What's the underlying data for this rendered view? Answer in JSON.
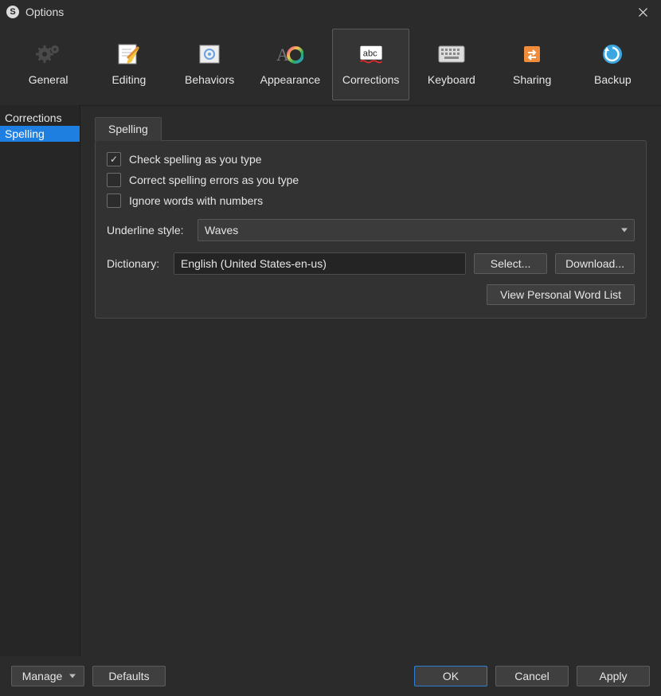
{
  "window": {
    "title": "Options"
  },
  "toolbar": {
    "items": [
      {
        "label": "General"
      },
      {
        "label": "Editing"
      },
      {
        "label": "Behaviors"
      },
      {
        "label": "Appearance"
      },
      {
        "label": "Corrections"
      },
      {
        "label": "Keyboard"
      },
      {
        "label": "Sharing"
      },
      {
        "label": "Backup"
      }
    ],
    "active_index": 4
  },
  "sidebar": {
    "items": [
      {
        "label": "Corrections"
      },
      {
        "label": "Spelling"
      }
    ],
    "selected_index": 1
  },
  "tab": {
    "label": "Spelling"
  },
  "spelling": {
    "check_as_type": {
      "label": "Check spelling as you type",
      "checked": true
    },
    "correct_as_type": {
      "label": "Correct spelling errors as you type",
      "checked": false
    },
    "ignore_numbers": {
      "label": "Ignore words with numbers",
      "checked": false
    },
    "underline_label": "Underline style:",
    "underline_value": "Waves",
    "dictionary_label": "Dictionary:",
    "dictionary_value": "English (United States-en-us)",
    "select_btn": "Select...",
    "download_btn": "Download...",
    "personal_list_btn": "View Personal Word List"
  },
  "footer": {
    "manage": "Manage",
    "defaults": "Defaults",
    "ok": "OK",
    "cancel": "Cancel",
    "apply": "Apply"
  }
}
